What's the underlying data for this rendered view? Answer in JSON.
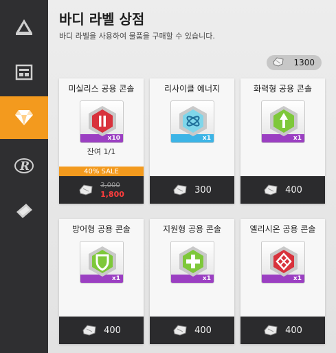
{
  "sidebar": {
    "items": [
      {
        "icon": "pyramid-icon"
      },
      {
        "icon": "grid-panel-icon"
      },
      {
        "icon": "diamond-icon",
        "active": true
      },
      {
        "icon": "r-logo-icon"
      },
      {
        "icon": "ticket-icon"
      }
    ]
  },
  "header": {
    "title": "바디 라벨 상점",
    "subtitle": "바디 라벨을 사용하여 물품을 구매할 수 있습니다."
  },
  "currency": {
    "amount": "1300",
    "icon": "label-currency-icon"
  },
  "colors": {
    "accent": "#f39a1e",
    "sidebar": "#2f2f31",
    "price_bar": "#2b2b2d",
    "sale_price": "#ff3d3d"
  },
  "cards": [
    {
      "name": "미실리스 공용 콘솔",
      "qty": "x10",
      "stock": "잔여 1/1",
      "sale": "40% SALE",
      "old_price": "3,000",
      "price": "1,800",
      "item_color": "#d8323c",
      "band_color": "#9b3fc2"
    },
    {
      "name": "리사이클 에너지",
      "qty": "x1",
      "price": "300",
      "item_color": "#4ec3e0",
      "band_color": "#3cb4e6"
    },
    {
      "name": "화력형 공용 콘솔",
      "qty": "x1",
      "price": "400",
      "item_color": "#7ec83a",
      "band_color": "#9b3fc2"
    },
    {
      "name": "방어형 공용 콘솔",
      "qty": "x1",
      "price": "400",
      "item_color": "#7ec83a",
      "band_color": "#9b3fc2"
    },
    {
      "name": "지원형 공용 콘솔",
      "qty": "x1",
      "price": "400",
      "item_color": "#7ec83a",
      "band_color": "#9b3fc2"
    },
    {
      "name": "엘리시온 공용 콘솔",
      "qty": "x1",
      "price": "400",
      "item_color": "#d8323c",
      "band_color": "#9b3fc2"
    }
  ]
}
